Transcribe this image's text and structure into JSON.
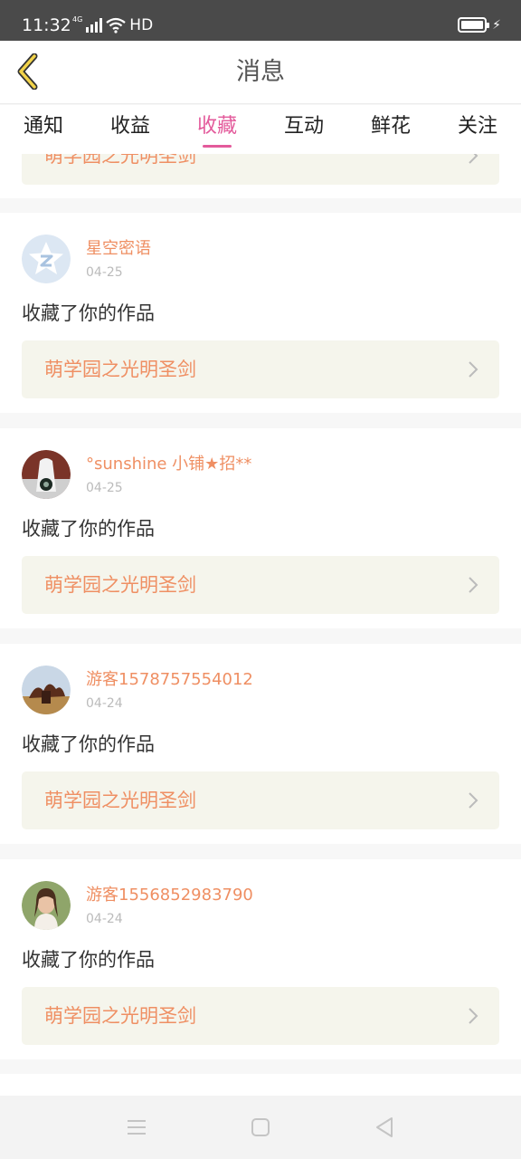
{
  "status_bar": {
    "time": "11:32",
    "network": "4G",
    "hd": "HD"
  },
  "header": {
    "title": "消息",
    "back_icon": "chevron-left-icon"
  },
  "tabs": [
    {
      "label": "通知",
      "active": false
    },
    {
      "label": "收益",
      "active": false
    },
    {
      "label": "收藏",
      "active": true
    },
    {
      "label": "互动",
      "active": false
    },
    {
      "label": "鲜花",
      "active": false
    },
    {
      "label": "关注",
      "active": false
    }
  ],
  "top_partial_item": {
    "work_title": "萌学园之光明圣剑"
  },
  "items": [
    {
      "username": "星空密语",
      "date": "04-25",
      "action": "收藏了你的作品",
      "work_title": "萌学园之光明圣剑",
      "avatar": "default-qzone-avatar"
    },
    {
      "username": "°sunshine 小铺★招**",
      "date": "04-25",
      "action": "收藏了你的作品",
      "work_title": "萌学园之光明圣剑",
      "avatar": "photo-avatar-bottle"
    },
    {
      "username": "游客1578757554012",
      "date": "04-24",
      "action": "收藏了你的作品",
      "work_title": "萌学园之光明圣剑",
      "avatar": "photo-avatar-landscape"
    },
    {
      "username": "游客1556852983790",
      "date": "04-24",
      "action": "收藏了你的作品",
      "work_title": "萌学园之光明圣剑",
      "avatar": "photo-avatar-girl"
    }
  ],
  "colors": {
    "accent": "#e35a9b",
    "username": "#ef8f63",
    "work_bg": "#f5f5ec",
    "statusbar": "#4a4a4a"
  }
}
